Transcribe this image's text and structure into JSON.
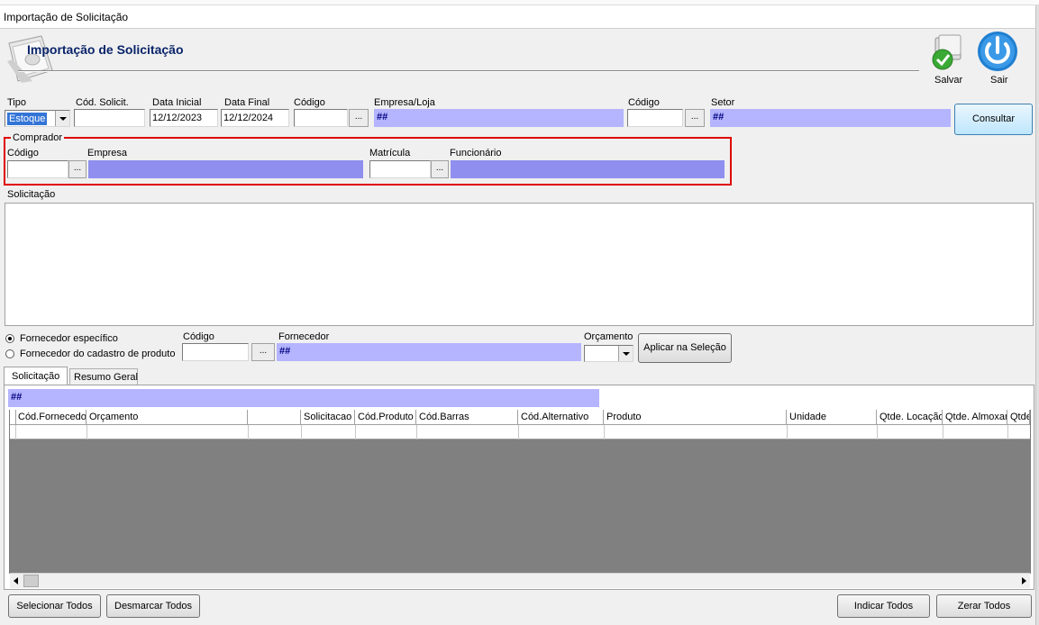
{
  "window": {
    "title": "Importação de Solicitação"
  },
  "header": {
    "title": "Importação de Solicitação"
  },
  "toolbar": {
    "save_label": "Salvar",
    "exit_label": "Sair"
  },
  "filters": {
    "tipo": {
      "label": "Tipo",
      "value": "Estoque"
    },
    "cod_solicit": {
      "label": "Cód. Solicit.",
      "value": ""
    },
    "data_inicial": {
      "label": "Data Inicial",
      "value": "12/12/2023"
    },
    "data_final": {
      "label": "Data Final",
      "value": "12/12/2024"
    },
    "codigo1": {
      "label": "Código",
      "value": ""
    },
    "empresa_loja": {
      "label": "Empresa/Loja",
      "value": "##"
    },
    "codigo2": {
      "label": "Código",
      "value": ""
    },
    "setor": {
      "label": "Setor",
      "value": "##"
    },
    "consultar_label": "Consultar",
    "ellipsis": "..."
  },
  "comprador": {
    "legend": "Comprador",
    "codigo_label": "Código",
    "empresa_label": "Empresa",
    "matricula_label": "Matrícula",
    "funcionario_label": "Funcionário",
    "codigo_value": "",
    "empresa_value": "",
    "matricula_value": "",
    "funcionario_value": ""
  },
  "solicitacao": {
    "label": "Solicitação"
  },
  "fornecedor": {
    "radio_especifico": "Fornecedor específico",
    "radio_cadastro": "Fornecedor do cadastro de produto",
    "selected": "especifico",
    "codigo_label": "Código",
    "codigo_value": "",
    "fornecedor_label": "Fornecedor",
    "fornecedor_value": "##",
    "orcamento_label": "Orçamento",
    "orcamento_value": "",
    "aplicar_label": "Aplicar na Seleção"
  },
  "tabs": [
    {
      "label": "Solicitação",
      "active": true
    },
    {
      "label": "Resumo Geral",
      "active": false
    }
  ],
  "grid": {
    "summary": "##",
    "columns": [
      "Cód.Fornecedor",
      "Orçamento",
      "",
      "Solicitacao",
      "Cód.Produto",
      "Cód.Barras",
      "Cód.Alternativo",
      "Produto",
      "Unidade",
      "Qtde. Locação",
      "Qtde. Almoxar",
      "Qtde"
    ]
  },
  "footer": {
    "select_all": "Selecionar Todos",
    "deselect_all": "Desmarcar Todos",
    "indicate_all": "Indicar Todos",
    "zero_all": "Zerar Todos"
  },
  "colors": {
    "display_field": "#b4b4ff",
    "highlight_border": "#e00000",
    "grid_empty": "#808080"
  }
}
